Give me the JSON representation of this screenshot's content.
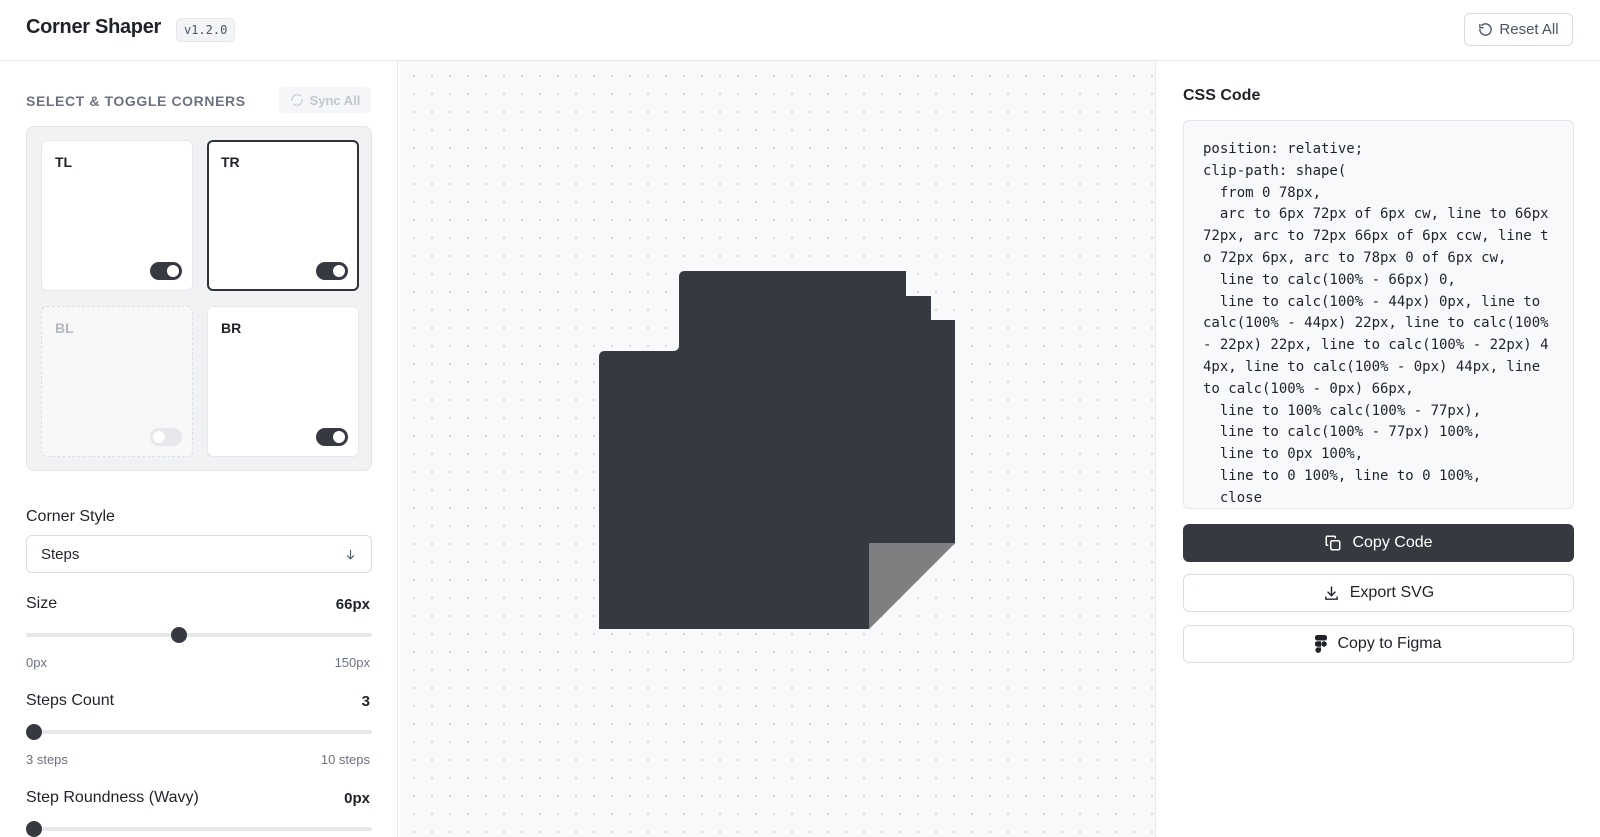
{
  "header": {
    "app_title": "Corner Shaper",
    "version": "v1.2.0",
    "reset_label": "Reset All"
  },
  "corners": {
    "section_label": "SELECT & TOGGLE CORNERS",
    "sync_label": "Sync All",
    "items": [
      {
        "label": "TL",
        "enabled": true,
        "selected": false
      },
      {
        "label": "TR",
        "enabled": true,
        "selected": true
      },
      {
        "label": "BL",
        "enabled": false,
        "selected": false
      },
      {
        "label": "BR",
        "enabled": true,
        "selected": false
      }
    ]
  },
  "style": {
    "label": "Corner Style",
    "value": "Steps"
  },
  "size": {
    "label": "Size",
    "value_text": "66px",
    "value": 66,
    "min": 0,
    "max": 150,
    "min_label": "0px",
    "max_label": "150px"
  },
  "steps": {
    "label": "Steps Count",
    "value_text": "3",
    "value": 3,
    "min": 3,
    "max": 10,
    "min_label": "3 steps",
    "max_label": "10 steps"
  },
  "roundness": {
    "label": "Step Roundness (Wavy)",
    "value_text": "0px",
    "value": 0,
    "min": 0,
    "max": 20
  },
  "code_panel": {
    "title": "CSS Code",
    "code": "position: relative;\nclip-path: shape(\n  from 0 78px,\n  arc to 6px 72px of 6px cw, line to 66px 72px, arc to 72px 66px of 6px ccw, line to 72px 6px, arc to 78px 0 of 6px cw,\n  line to calc(100% - 66px) 0,\n  line to calc(100% - 44px) 0px, line to calc(100% - 44px) 22px, line to calc(100% - 22px) 22px, line to calc(100% - 22px) 44px, line to calc(100% - 0px) 44px, line to calc(100% - 0px) 66px,\n  line to 100% calc(100% - 77px),\n  line to calc(100% - 77px) 100%,\n  line to 0px 100%,\n  line to 0 100%, line to 0 100%,\n  close"
  },
  "actions": {
    "copy_code": "Copy Code",
    "export_svg": "Export SVG",
    "copy_figma": "Copy to Figma"
  },
  "colors": {
    "shape_fill": "#363a40",
    "fold_fill": "#7d7f81",
    "accent": "#363a40"
  },
  "icons": {
    "reset": "rotate-ccw-icon",
    "sync": "refresh-icon",
    "select": "arrow-down-icon",
    "copy": "copy-icon",
    "export": "download-icon",
    "figma": "figma-icon"
  }
}
